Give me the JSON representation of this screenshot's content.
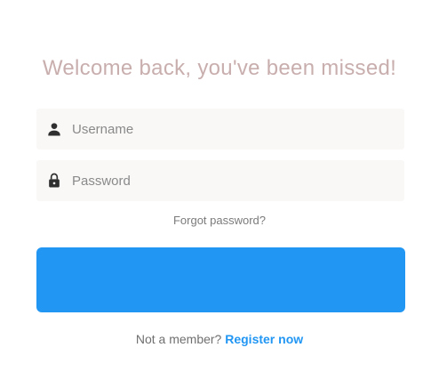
{
  "login": {
    "title": "Welcome back, you've been missed!",
    "username": {
      "placeholder": "Username",
      "value": "",
      "icon": "person-icon"
    },
    "password": {
      "placeholder": "Password",
      "value": "",
      "icon": "lock-icon"
    },
    "forgot_label": "Forgot password?",
    "submit_label": "",
    "register": {
      "prompt": "Not a member?",
      "link_label": "Register now"
    }
  },
  "colors": {
    "title": "#c9aeae",
    "field_bg": "#f9f8f7",
    "accent": "#2196f3",
    "icon": "#2f2f2f"
  }
}
